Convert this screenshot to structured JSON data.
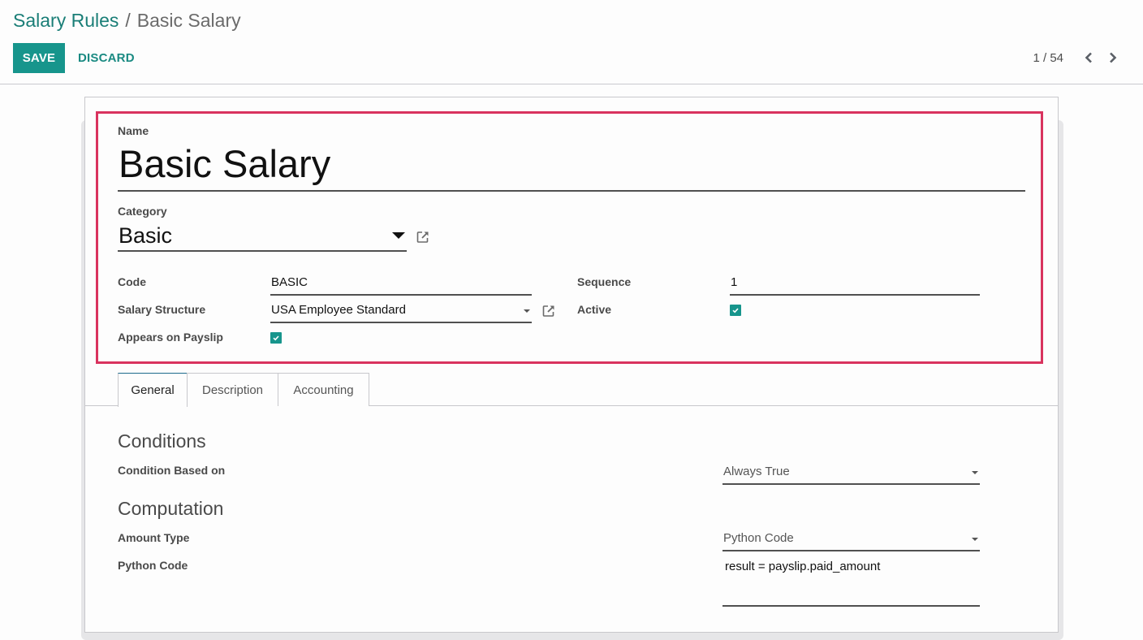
{
  "breadcrumb": {
    "parent": "Salary Rules",
    "separator": "/",
    "current": "Basic Salary"
  },
  "toolbar": {
    "save_label": "SAVE",
    "discard_label": "DISCARD"
  },
  "pager": {
    "value": "1 / 54",
    "prev_icon": "chevron-left-icon",
    "next_icon": "chevron-right-icon"
  },
  "colors": {
    "brand": "#17958c",
    "highlight": "#d9335e",
    "tab_active_top": "#1d6b8c"
  },
  "form": {
    "name_label": "Name",
    "name_value": "Basic Salary",
    "category_label": "Category",
    "category_value": "Basic",
    "code_label": "Code",
    "code_value": "BASIC",
    "salary_structure_label": "Salary Structure",
    "salary_structure_value": "USA Employee Standard",
    "appears_on_payslip_label": "Appears on Payslip",
    "appears_on_payslip_checked": true,
    "sequence_label": "Sequence",
    "sequence_value": "1",
    "active_label": "Active",
    "active_checked": true
  },
  "tabs": [
    {
      "label": "General",
      "active": true
    },
    {
      "label": "Description",
      "active": false
    },
    {
      "label": "Accounting",
      "active": false
    }
  ],
  "general": {
    "conditions_title": "Conditions",
    "condition_based_on_label": "Condition Based on",
    "condition_based_on_value": "Always True",
    "computation_title": "Computation",
    "amount_type_label": "Amount Type",
    "amount_type_value": "Python Code",
    "python_code_label": "Python Code",
    "python_code_value": "result = payslip.paid_amount"
  }
}
